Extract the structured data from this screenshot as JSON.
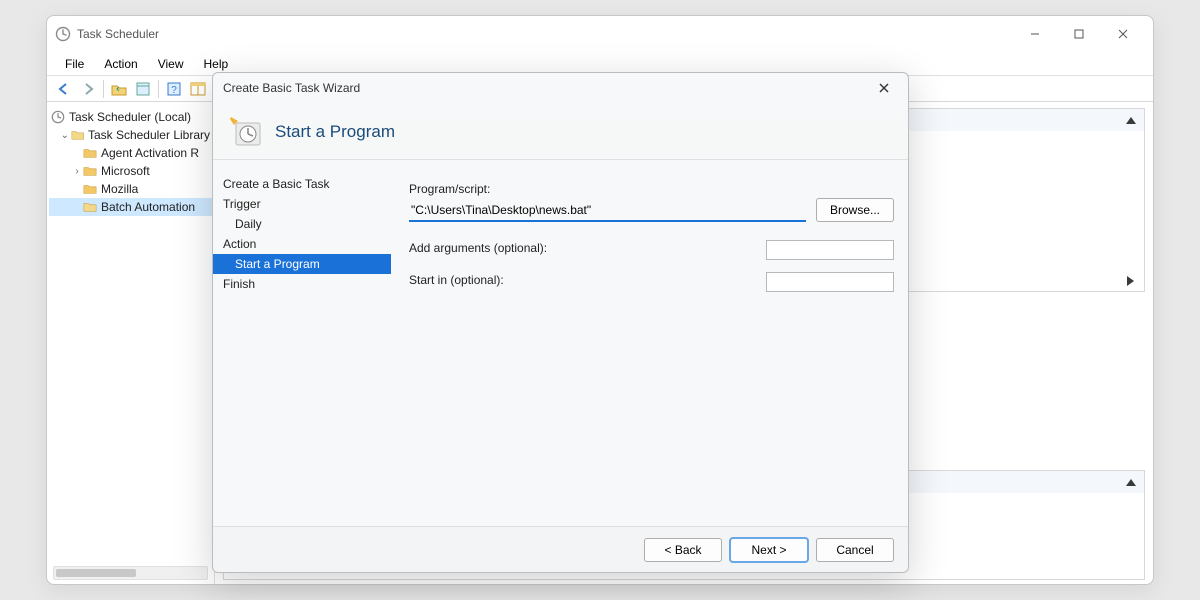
{
  "main_window": {
    "title": "Task Scheduler",
    "menu": {
      "file": "File",
      "action": "Action",
      "view": "View",
      "help": "Help"
    },
    "tree": {
      "root": "Task Scheduler (Local)",
      "library": "Task Scheduler Library",
      "items": [
        "Agent Activation R",
        "Microsoft",
        "Mozilla",
        "Batch Automation"
      ]
    }
  },
  "wizard": {
    "title": "Create Basic Task Wizard",
    "heading": "Start a Program",
    "nav": {
      "create": "Create a Basic Task",
      "trigger": "Trigger",
      "trigger_sub": "Daily",
      "action": "Action",
      "action_sub": "Start a Program",
      "finish": "Finish"
    },
    "form": {
      "program_label": "Program/script:",
      "program_value": "\"C:\\Users\\Tina\\Desktop\\news.bat\"",
      "browse": "Browse...",
      "args_label": "Add arguments (optional):",
      "args_value": "",
      "startin_label": "Start in (optional):",
      "startin_value": ""
    },
    "buttons": {
      "back": "< Back",
      "next": "Next >",
      "cancel": "Cancel"
    }
  }
}
